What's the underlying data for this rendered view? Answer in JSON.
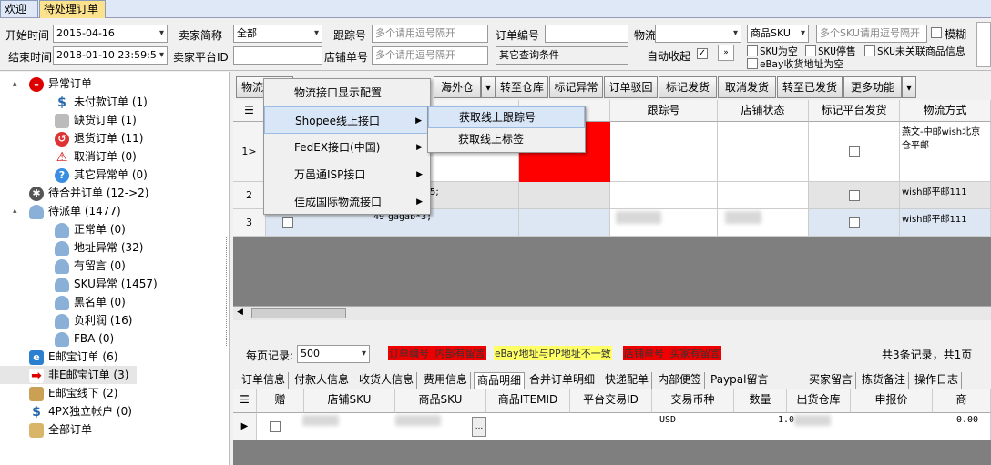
{
  "tabs": [
    "欢迎",
    "待处理订单"
  ],
  "filters": {
    "start_time_label": "开始时间",
    "start_time": "2015-04-16",
    "end_time_label": "结束时间",
    "end_time": "2018-01-10 23:59:5",
    "seller_short_label": "卖家简称",
    "seller_short": "全部",
    "platform_id_label": "卖家平台ID",
    "tracking_label": "跟踪号",
    "tracking_ph": "多个请用逗号隔开",
    "shop_no_label": "店铺单号",
    "shop_no_ph": "多个请用逗号隔开",
    "order_no_label": "订单编号",
    "logistics_label": "物流方式",
    "other_query": "其它查询条件",
    "auto_collapse_label": "自动收起",
    "sku_select": "商品SKU",
    "sku_ph": "多个SKU请用逗号隔开",
    "fuzzy_label": "模糊",
    "sku_empty": "SKU为空",
    "sku_stop": "SKU停售",
    "sku_unlinked": "SKU未关联商品信息",
    "ebay_addr_empty": "eBay收货地址为空"
  },
  "tree": [
    {
      "label": "异常订单",
      "icon": "stop-icon",
      "level": 0
    },
    {
      "label": "未付款订单 (1)",
      "icon": "dollar-icon",
      "level": 1
    },
    {
      "label": "缺货订单 (1)",
      "icon": "box-icon",
      "level": 1
    },
    {
      "label": "退货订单 (11)",
      "icon": "return-icon",
      "level": 1
    },
    {
      "label": "取消订单 (0)",
      "icon": "warning-icon",
      "level": 1
    },
    {
      "label": "其它异常单 (0)",
      "icon": "help-icon",
      "level": 1
    },
    {
      "label": "待合并订单 (12->2)",
      "icon": "gear-icon",
      "level": 0
    },
    {
      "label": "待派单 (1477)",
      "icon": "user-icon",
      "level": 0
    },
    {
      "label": "正常单 (0)",
      "icon": "user-icon",
      "level": 1
    },
    {
      "label": "地址异常 (32)",
      "icon": "user-icon",
      "level": 1
    },
    {
      "label": "有留言 (0)",
      "icon": "user-icon",
      "level": 1
    },
    {
      "label": "SKU异常 (1457)",
      "icon": "user-icon",
      "level": 1
    },
    {
      "label": "黑名单 (0)",
      "icon": "user-icon",
      "level": 1
    },
    {
      "label": "负利润 (16)",
      "icon": "user-icon",
      "level": 1
    },
    {
      "label": "FBA (0)",
      "icon": "user-icon",
      "level": 1
    },
    {
      "label": "E邮宝订单 (6)",
      "icon": "e-icon",
      "level": 0
    },
    {
      "label": "非E邮宝订单 (3)",
      "icon": "arrow-right-icon",
      "level": 0
    },
    {
      "label": "E邮宝线下 (2)",
      "icon": "package-icon",
      "level": 0
    },
    {
      "label": "4PX独立帐户 (0)",
      "icon": "dollar-icon",
      "level": 0
    },
    {
      "label": "全部订单",
      "icon": "boxes-icon",
      "level": 0
    }
  ],
  "toolbar": {
    "logistics": "物流",
    "overseas": "海外仓",
    "to_warehouse": "转至仓库",
    "mark_abnormal": "标记异常",
    "reject_order": "订单驳回",
    "mark_shipped": "标记发货",
    "cancel_ship": "取消发货",
    "to_shipped": "转至已发货",
    "more": "更多功能"
  },
  "menu": {
    "items": [
      "物流接口显示配置",
      "Shopee线上接口",
      "FedEX接口(中国)",
      "万邑通ISP接口",
      "佳成国际物流接口"
    ],
    "submenu": [
      "获取线上跟踪号",
      "获取线上标签"
    ]
  },
  "grid": {
    "headers": [
      "跟踪号",
      "店铺状态",
      "标记平台发货",
      "物流方式"
    ],
    "rows": [
      {
        "num": "1>",
        "logistics": "燕文-中邮wish北京仓平邮"
      },
      {
        "num": "2",
        "sku": "5;",
        "logistics": "wish邮平邮111"
      },
      {
        "num": "3",
        "qty": "49",
        "sku": "gagab*3;",
        "logistics": "wish邮平邮111"
      }
    ]
  },
  "status": {
    "per_page_label": "每页记录:",
    "per_page": "500",
    "legend_red1": "订单编号 内部有留言",
    "legend_yellow": "eBay地址与PP地址不一致",
    "legend_red2": "店铺单号 买家有留言",
    "total": "共3条记录，共1页"
  },
  "subtabs": [
    "订单信息",
    "付款人信息",
    "收货人信息",
    "费用信息",
    "商品明细",
    "合并订单明细",
    "快递配单",
    "内部便签",
    "Paypal留言",
    "买家留言",
    "拣货备注",
    "操作日志"
  ],
  "detail": {
    "headers": [
      "赠",
      "店铺SKU",
      "商品SKU",
      "商品ITEMID",
      "平台交易ID",
      "交易币种",
      "数量",
      "出货仓库",
      "申报价",
      "商"
    ],
    "row": {
      "currency": "USD",
      "qty": "1.0",
      "price": "0.00",
      "btn": "..."
    }
  },
  "colors": {
    "tab_active": "#fce28c",
    "red_cell": "#ff0000",
    "legend_yellow": "#ffff66"
  }
}
